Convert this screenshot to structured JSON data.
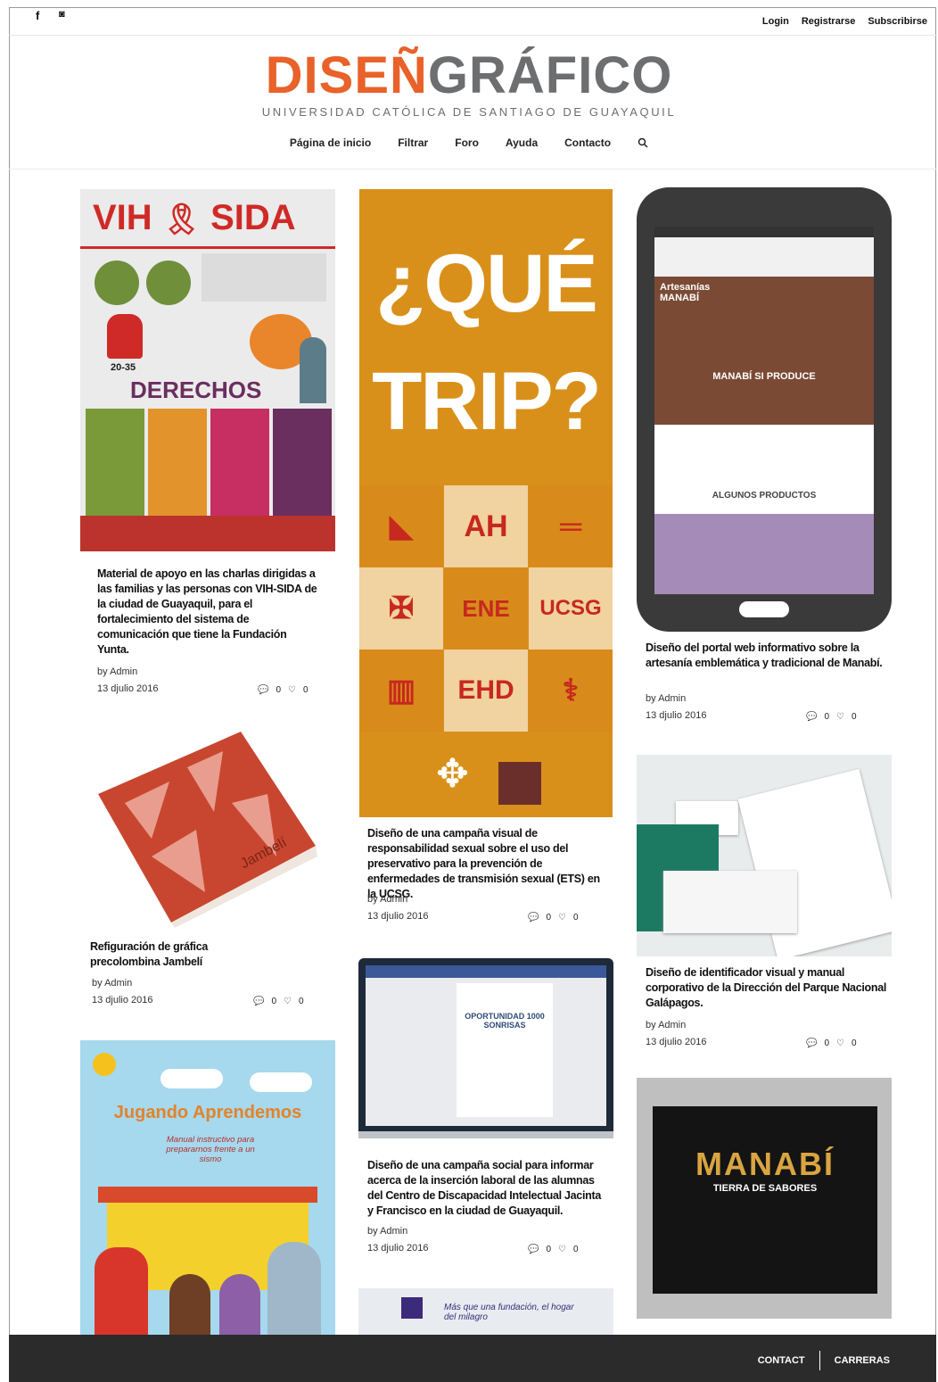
{
  "social": {
    "facebook_glyph": "f",
    "instagram_glyph": "◙"
  },
  "account": {
    "login": "Login",
    "register": "Registrarse",
    "subscribe": "Subscribirse"
  },
  "brand": {
    "part1": "DISEÑ",
    "part2": "GRÁFICO",
    "tagline": "UNIVERSIDAD CATÓLICA DE SANTIAGO DE GUAYAQUIL",
    "accent_color": "#e8622a",
    "gray_color": "#6d6e70"
  },
  "nav": {
    "items": [
      "Página de inicio",
      "Filtrar",
      "Foro",
      "Ayuda",
      "Contacto"
    ],
    "search_icon": "search-icon"
  },
  "posts": {
    "vih": {
      "image_title": "VIH",
      "image_title2": "SIDA",
      "image_section": "DERECHOS",
      "image_year": "20-35",
      "text": "Material de apoyo en las charlas dirigidas a las familias y las personas con VIH-SIDA de la ciudad de Guayaquil, para el fortalecimiento del sistema de comunicación que tiene la Fundación Yunta.",
      "by": "by Admin",
      "date": "13 djulio 2016",
      "comments": "0",
      "likes": "0"
    },
    "trip": {
      "image_line1": "¿QUÉ",
      "image_line2": "TRIP?",
      "tiles": [
        "AH",
        "ENE",
        "UCSG",
        "EHD"
      ],
      "text": "Diseño de una campaña visual de responsabilidad sexual sobre el uso del preservativo para la prevención de enfermedades de transmisión sexual (ETS) en la UCSG.",
      "by": "by Admin",
      "date": "13 djulio 2016",
      "comments": "0",
      "likes": "0"
    },
    "manabi_web": {
      "screen_brand": "Artesanías MANABÍ",
      "screen_hero": "MANABÍ SI PRODUCE",
      "screen_section": "ALGUNOS PRODUCTOS",
      "text": "Diseño del portal web informativo sobre la artesanía emblemática y tradicional de Manabí.",
      "by": "by Admin",
      "date": "13 djulio 2016",
      "comments": "0",
      "likes": "0"
    },
    "jambeli": {
      "image_word": "Jambelí",
      "text": "Refiguración de gráfica precolombina Jambelí",
      "by": "by Admin",
      "date": "13 djulio 2016",
      "comments": "0",
      "likes": "0"
    },
    "galapagos": {
      "text": "Diseño de identificador visual y manual corporativo de la Dirección del Parque Nacional Galápagos.",
      "by": "by Admin",
      "date": "13 djulio 2016",
      "comments": "0",
      "likes": "0"
    },
    "jacinta": {
      "screen_banner": "OPORTUNIDAD 1000 SONRISAS",
      "text": "Diseño de una campaña social para informar acerca de la inserción laboral de las alumnas del Centro de Discapacidad Intelectual Jacinta y Francisco en la ciudad de Guayaquil.",
      "by": "by Admin",
      "date": "13 djulio 2016",
      "comments": "0",
      "likes": "0"
    },
    "jugando": {
      "image_title": "Jugando Aprendemos",
      "image_subtitle": "Manual instructivo para prepararnos frente a un sismo"
    },
    "manabi_book": {
      "image_title": "MANABÍ",
      "image_subtitle": "TIERRA DE SABORES"
    },
    "fundacion": {
      "image_text": "Más que una fundación, el hogar del milagro"
    }
  },
  "footer": {
    "contact": "CONTACT",
    "careers": "CARRERAS"
  }
}
